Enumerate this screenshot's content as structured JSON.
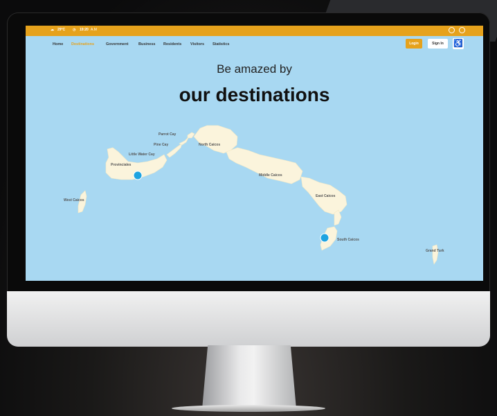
{
  "top_bar": {
    "weather": "29°C",
    "time": "19:20",
    "time_suffix": "A.M"
  },
  "nav": {
    "links": [
      "Home",
      "Destinations",
      "Government",
      "Business",
      "Residents",
      "Visitors",
      "Statistics"
    ],
    "active": "Destinations",
    "login": "Login",
    "signin": "Sign In"
  },
  "hero": {
    "line1": "Be amazed by",
    "line2": "our destinations"
  },
  "map": {
    "labels": [
      "Parrot Cay",
      "Pine Cay",
      "North Caicos",
      "Little Water Cay",
      "Provinciales",
      "Middle Caicos",
      "East Caicos",
      "West Caicos",
      "South Caicos",
      "Grand Turk"
    ]
  },
  "colors": {
    "accent": "#e6a21c",
    "sea": "#a8d8f2",
    "land": "#fbf4dc",
    "airport": "#1ea3e0"
  }
}
